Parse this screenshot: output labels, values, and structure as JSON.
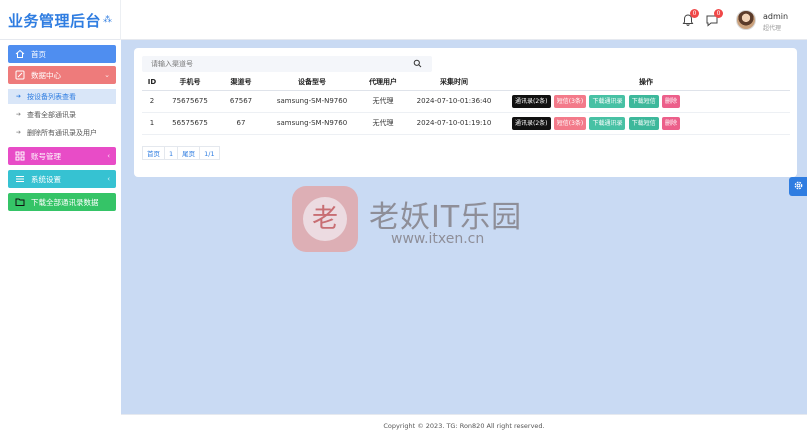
{
  "app": {
    "title": "业务管理后台",
    "title_mark": "⁂"
  },
  "header": {
    "notifications": {
      "bell_count": "0",
      "chat_count": "0"
    },
    "user": {
      "name": "admin",
      "role": "超代理"
    }
  },
  "sidebar": {
    "menus": [
      {
        "label": "首页",
        "icon": "home-icon",
        "color": "#4f8ef0"
      },
      {
        "label": "数据中心",
        "icon": "edit-icon",
        "color": "#ee7b7b"
      },
      {
        "label": "账号管理",
        "icon": "grid-icon",
        "color": "#e84cc7"
      },
      {
        "label": "系统设置",
        "icon": "list-icon",
        "color": "#36c2d2"
      },
      {
        "label": "下载全部通讯录数据",
        "icon": "folder-icon",
        "color": "#35c467"
      }
    ],
    "submenu": [
      {
        "label": "按设备列表查看"
      },
      {
        "label": "查看全部通讯录"
      },
      {
        "label": "删除所有通讯录及用户"
      }
    ]
  },
  "search": {
    "placeholder": "请输入渠道号"
  },
  "table": {
    "headers": [
      "ID",
      "手机号",
      "渠道号",
      "设备型号",
      "代理用户",
      "采集时间",
      "操作"
    ],
    "rows": [
      {
        "id": "2",
        "phone": "75675675",
        "channel": "67567",
        "device": "samsung-SM-N9760",
        "agent": "无代理",
        "time": "2024-07-10-01:36:40",
        "contacts": "通讯录(2条)",
        "sms": "短信(3条)",
        "dl_contacts": "下载通讯录",
        "dl_sms": "下载短信",
        "delete": "删除"
      },
      {
        "id": "1",
        "phone": "56575675",
        "channel": "67",
        "device": "samsung-SM-N9760",
        "agent": "无代理",
        "time": "2024-07-10-01:19:10",
        "contacts": "通讯录(2条)",
        "sms": "短信(3条)",
        "dl_contacts": "下载通讯录",
        "dl_sms": "下载短信",
        "delete": "删除"
      }
    ]
  },
  "pagination": {
    "first": "首页",
    "current": "1",
    "last": "尾页",
    "info": "1/1"
  },
  "watermark": {
    "logo_char": "老",
    "title": "老妖IT乐园",
    "url": "www.itxen.cn"
  },
  "footer": {
    "text": "Copyright © 2023. TG: Ron820 All right reserved."
  },
  "colors": {
    "accent": "#2f7de1",
    "background": "#c9daf3"
  }
}
